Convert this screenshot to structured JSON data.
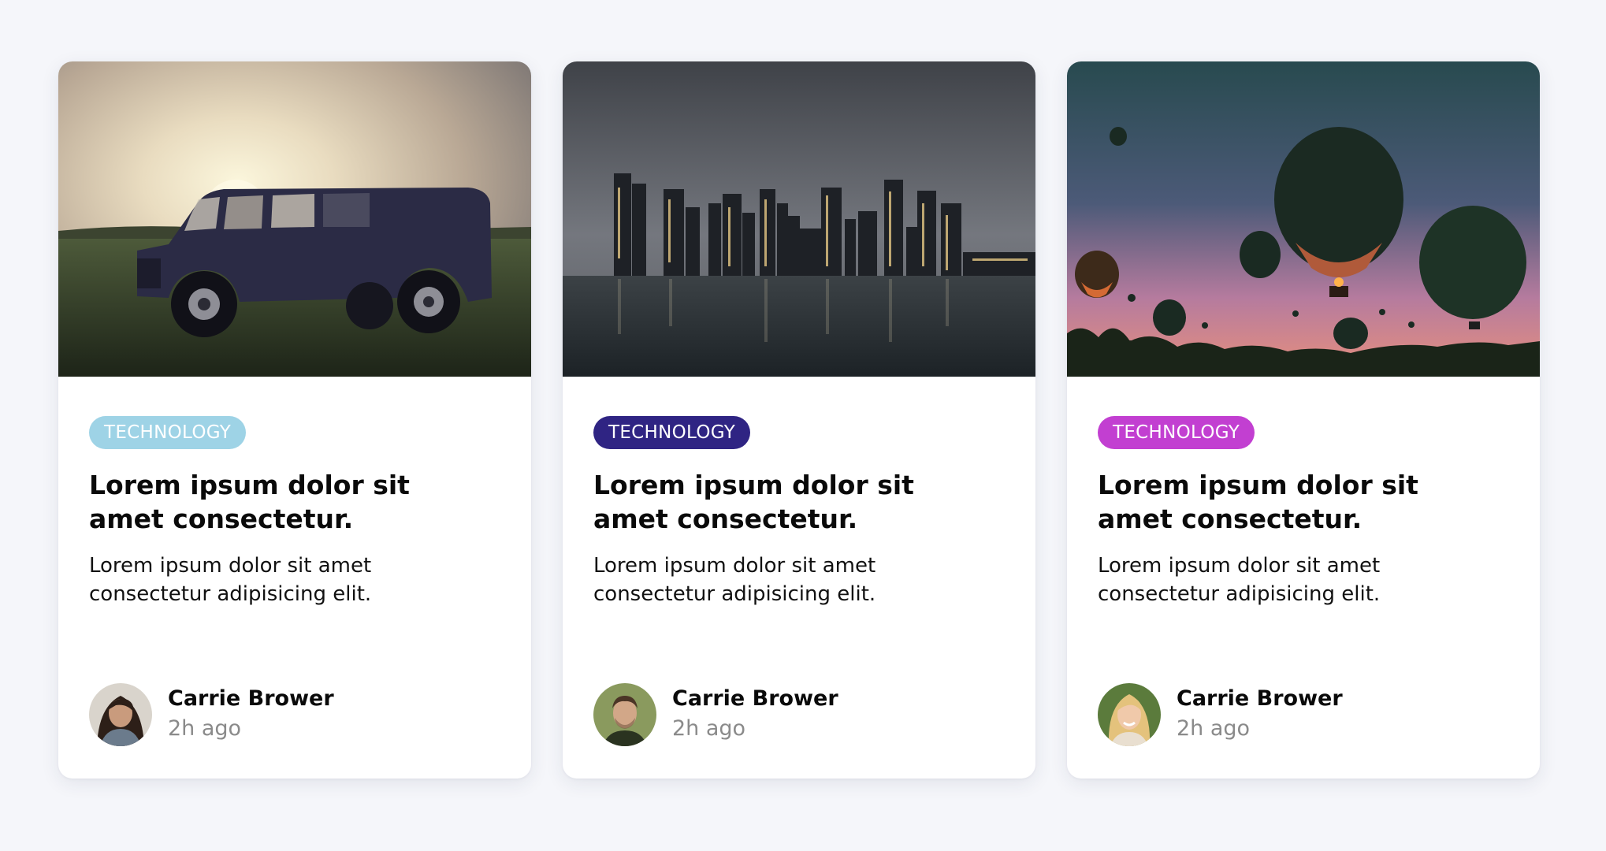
{
  "cards": [
    {
      "image": "vintage-truck-at-sunset",
      "tag": "TECHNOLOGY",
      "tag_color": "#9ed3e6",
      "title": "Lorem ipsum dolor sit amet consectetur.",
      "description": "Lorem ipsum dolor sit amet consectetur adipisicing elit.",
      "author": {
        "name": "Carrie Brower",
        "time": "2h ago",
        "avatar": "woman-dark-hair"
      }
    },
    {
      "image": "city-skyline-at-night",
      "tag": "TECHNOLOGY",
      "tag_color": "#2f2483",
      "title": "Lorem ipsum dolor sit amet consectetur.",
      "description": "Lorem ipsum dolor sit amet consectetur adipisicing elit.",
      "author": {
        "name": "Carrie Brower",
        "time": "2h ago",
        "avatar": "man-short-hair"
      }
    },
    {
      "image": "hot-air-balloons-at-dusk",
      "tag": "TECHNOLOGY",
      "tag_color": "#c23fd1",
      "title": "Lorem ipsum dolor sit amet consectetur.",
      "description": "Lorem ipsum dolor sit amet consectetur adipisicing elit.",
      "author": {
        "name": "Carrie Brower",
        "time": "2h ago",
        "avatar": "woman-blonde-hair"
      }
    }
  ]
}
